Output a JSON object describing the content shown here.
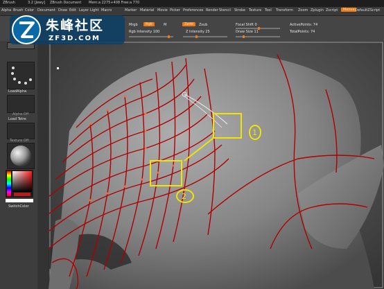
{
  "titlebar": {
    "app_label": "ZBrush",
    "version": "3.2 [Jewy]",
    "document": "ZBrush Document",
    "memory": "Mem:a 2275+408 Free:a 770"
  },
  "menubar": {
    "items": [
      "Alpha",
      "Brush",
      "Color",
      "Document",
      "Draw",
      "Edit",
      "Layer",
      "Light",
      "Macro",
      "Marker",
      "Material",
      "Movie",
      "Picker",
      "Preferences",
      "Render",
      "Stencil",
      "Stroke",
      "Texture",
      "Tool",
      "Transform",
      "Zoom",
      "Zplugin",
      "Zscript"
    ],
    "menus_button": "Menus",
    "script_label": "DefaultZScript"
  },
  "toolbar": {
    "mrgb": "Mrgb",
    "rgb": "Rgb",
    "m": "M",
    "rgb_intensity": "Rgb Intensity 100",
    "zadd": "Zadd",
    "zsub": "Zsub",
    "z_intensity": "Z Intensity 25",
    "focal_shift": "Focal Shift 0",
    "draw_size": "Draw Size 11",
    "active_points": "ActivePoints: 74",
    "total_points": "TotalPoints: 74"
  },
  "logo": {
    "chinese_text": "朱峰社区",
    "domain_text": "ZF3D.COM",
    "colors": {
      "badge": "#0a6aa8",
      "text": "#ffffff"
    }
  },
  "leftpanel": {
    "load_alpha": "LoadAlpha",
    "alpha_off": "Alpha Off",
    "load_texture": "Load Tetre",
    "texture_off": "Texture Off",
    "switch_color": "SwitchColor"
  },
  "annotations": {
    "label_1": "1",
    "label_2": "2",
    "color": "#f0e400"
  },
  "colors": {
    "accent": "#f07a12",
    "topology": "#b00000"
  }
}
